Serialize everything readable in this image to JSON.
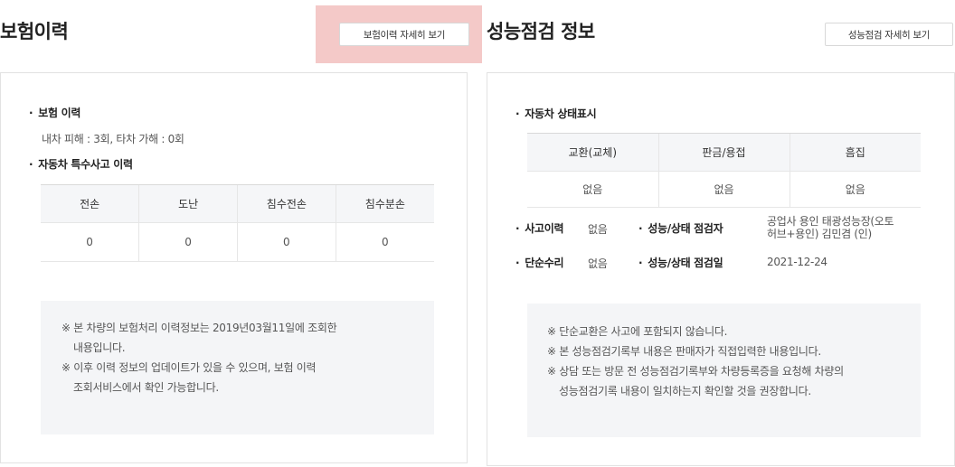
{
  "insurance": {
    "title": "보험이력",
    "detail_button": "보험이력 자세히 보기",
    "history_heading": "보험 이력",
    "damage_summary": "내차 피해 : 3회, 타차 가해 : 0회",
    "special_heading": "자동차 특수사고 이력",
    "table": {
      "headers": [
        "전손",
        "도난",
        "침수전손",
        "침수분손"
      ],
      "values": [
        "0",
        "0",
        "0",
        "0"
      ]
    },
    "notes": [
      "※ 본 차량의 보험처리 이력정보는 2019년03월11일에 조회한",
      "내용입니다.",
      "※ 이후 이력 정보의 업데이트가 있을 수 있으며, 보험 이력",
      "조회서비스에서 확인 가능합니다."
    ]
  },
  "inspection": {
    "title": "성능점검 정보",
    "detail_button": "성능점검 자세히 보기",
    "status_heading": "자동차 상태표시",
    "table": {
      "headers": [
        "교환(교체)",
        "판금/용접",
        "흠집"
      ],
      "values": [
        "없음",
        "없음",
        "없음"
      ]
    },
    "accident_label": "사고이력",
    "accident_value": "없음",
    "simple_repair_label": "단순수리",
    "simple_repair_value": "없음",
    "inspector_label": "성능/상태 점검자",
    "inspector_value_line1": "공업사 용인 태광성능장(오토",
    "inspector_value_line2": "허브+용인) 김민겸 (인)",
    "date_label": "성능/상태 점검일",
    "date_value": "2021-12-24",
    "notes": [
      "※ 단순교환은 사고에 포함되지 않습니다.",
      "※ 본 성능점검기록부 내용은 판매자가 직접입력한 내용입니다.",
      "※ 상담 또는 방문 전 성능점검기록부와 차량등록증을 요청해 차량의",
      "성능점검기록 내용이 일치하는지 확인할 것을 권장합니다."
    ]
  },
  "bullet": "·"
}
